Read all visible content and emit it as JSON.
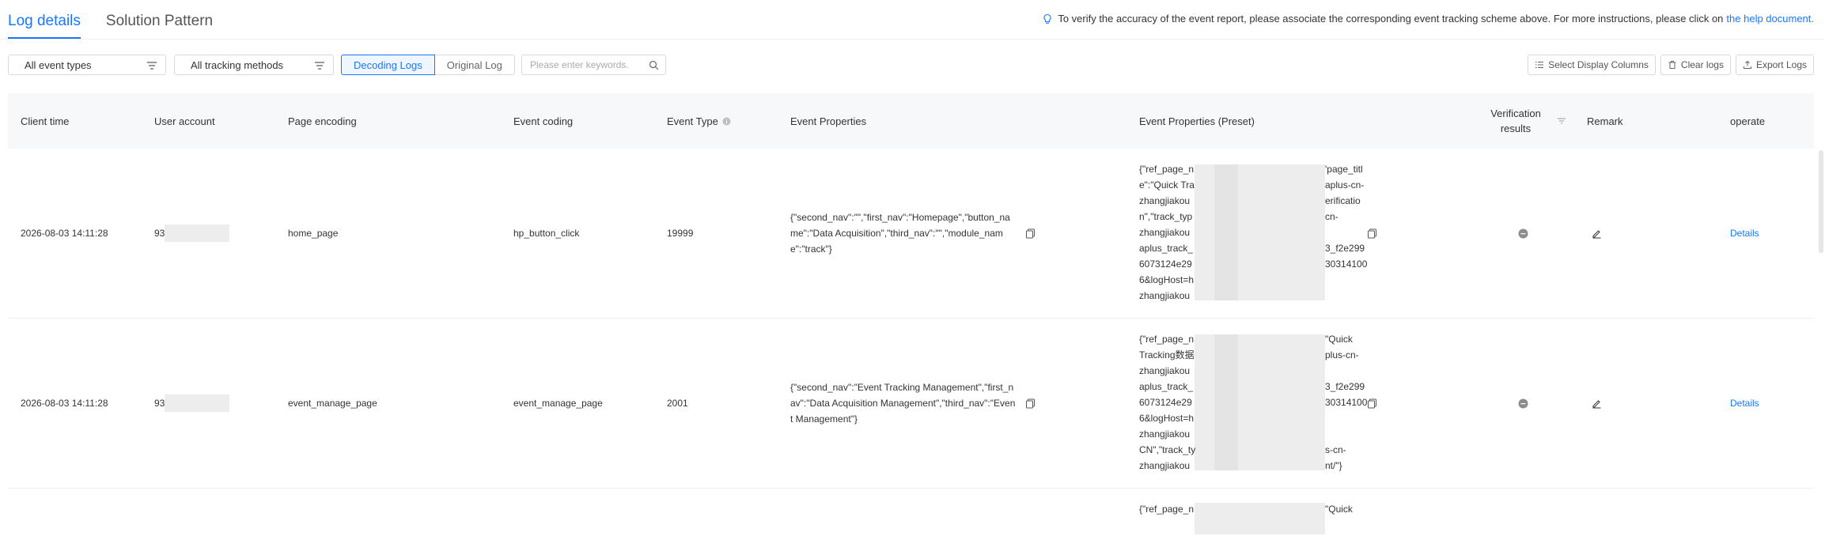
{
  "tabs": [
    {
      "label": "Log details",
      "active": true
    },
    {
      "label": "Solution Pattern",
      "active": false
    }
  ],
  "notice": {
    "text": "To verify the accuracy of the event report, please associate the corresponding event tracking scheme above. For more instructions, please click on",
    "link": "the help document."
  },
  "filters": {
    "event_types": "All event types",
    "tracking_methods": "All tracking methods",
    "decoding": "Decoding Logs",
    "original": "Original Log",
    "search_placeholder": "Please enter keywords."
  },
  "actions": {
    "select_columns": "Select Display Columns",
    "clear": "Clear logs",
    "export": "Export Logs"
  },
  "table": {
    "headers": {
      "client_time": "Client time",
      "user_account": "User account",
      "page_encoding": "Page encoding",
      "event_coding": "Event coding",
      "event_type": "Event Type",
      "event_properties": "Event Properties",
      "event_properties_preset": "Event Properties (Preset)",
      "verification_1": "Verification",
      "verification_2": "results",
      "remark": "Remark",
      "operate": "operate"
    },
    "rows": [
      {
        "client_time": "2026-08-03 14:11:28",
        "user_account": "93",
        "page_encoding": "home_page",
        "event_coding": "hp_button_click",
        "event_type": "19999",
        "event_properties": "{\"second_nav\":\"\",\"first_nav\":\"Homepage\",\"button_name\":\"Data Acquisition\",\"third_nav\":\"\",\"module_name\":\"track\"}",
        "preset_lines": [
          {
            "left": "{\"ref_page_n",
            "right": "'page_titl"
          },
          {
            "left": "e\":\"Quick Tra",
            "right": "aplus-cn-"
          },
          {
            "left": "zhangjiakou",
            "right": "erificatio"
          },
          {
            "left": "n\",\"track_typ",
            "right": "cn-"
          },
          {
            "left": "zhangjiakou",
            "right": ""
          },
          {
            "left": "aplus_track_",
            "right": "3_f2e299"
          },
          {
            "left": "6073124e29",
            "right": "30314100"
          },
          {
            "left": "6&logHost=h",
            "right": ""
          },
          {
            "left": "zhangjiakou",
            "right": ""
          }
        ],
        "details": "Details"
      },
      {
        "client_time": "2026-08-03 14:11:28",
        "user_account": "93",
        "page_encoding": "event_manage_page",
        "event_coding": "event_manage_page",
        "event_type": "2001",
        "event_properties": "{\"second_nav\":\"Event Tracking Management\",\"first_nav\":\"Data Acquisition Management\",\"third_nav\":\"Event Management\"}",
        "preset_lines": [
          {
            "left": "{\"ref_page_n",
            "right": "\"Quick"
          },
          {
            "left": "Tracking数据",
            "right": "plus-cn-"
          },
          {
            "left": "zhangjiakou",
            "right": ""
          },
          {
            "left": "aplus_track_",
            "right": "3_f2e299"
          },
          {
            "left": "6073124e29",
            "right": "30314100"
          },
          {
            "left": "6&logHost=h",
            "right": ""
          },
          {
            "left": "zhangjiakou",
            "right": ""
          },
          {
            "left": "CN\",\"track_ty",
            "right": "s-cn-"
          },
          {
            "left": "zhangjiakou",
            "right": "nt/\"}"
          }
        ],
        "details": "Details"
      },
      {
        "preset_lines": [
          {
            "left": "{\"ref_page_n",
            "right": "\"Quick"
          }
        ]
      }
    ]
  },
  "colors": {
    "accent": "#1677ff"
  }
}
